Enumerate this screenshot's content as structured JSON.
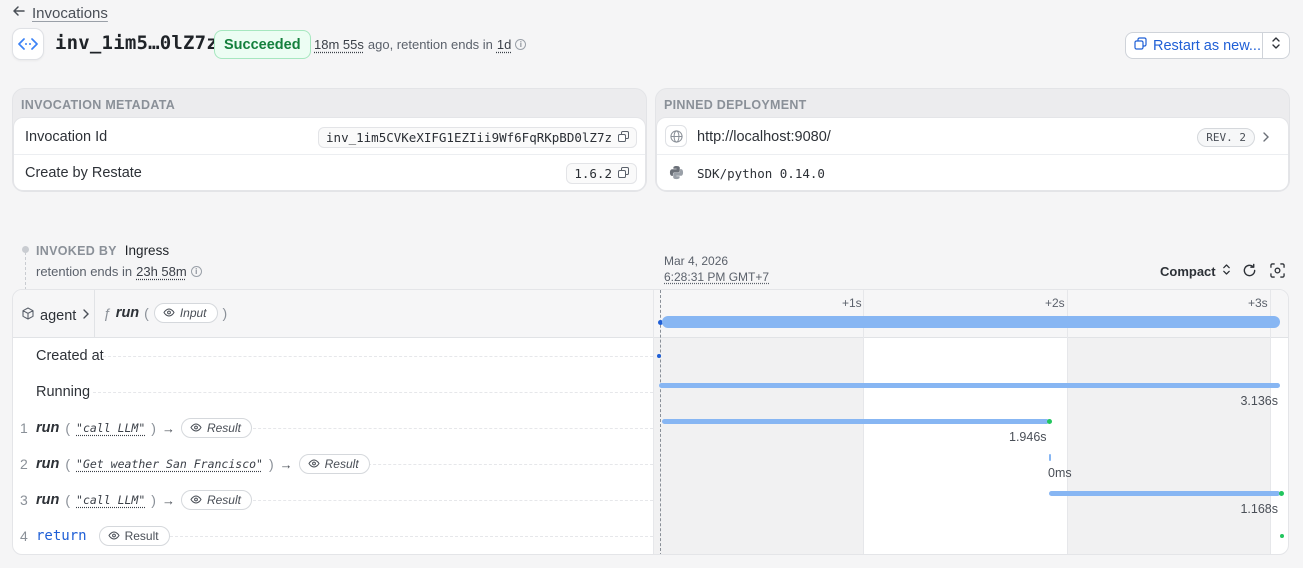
{
  "nav": {
    "back_label": "Invocations"
  },
  "header": {
    "invocation_short": "inv_1im5…0lZ7z",
    "status": "Succeeded",
    "age": "18m 55s",
    "age_suffix": "ago, retention ends in",
    "retention": "1d",
    "restart_label": "Restart as new..."
  },
  "metadata": {
    "title": "INVOCATION METADATA",
    "rows": [
      {
        "label": "Invocation Id",
        "value": "inv_1im5CVKeXIFG1EZIii9Wf6FqRKpBD0lZ7z"
      },
      {
        "label": "Create by Restate",
        "value": "1.6.2"
      }
    ]
  },
  "deployment": {
    "title": "PINNED DEPLOYMENT",
    "url": "http://localhost:9080/",
    "revision": "REV. 2",
    "sdk": "SDK/python 0.14.0"
  },
  "invoked_by": {
    "label": "INVOKED BY",
    "value": "Ingress",
    "retention_prefix": "retention ends in",
    "retention": "23h 58m"
  },
  "timeline_header": {
    "date": "Mar 4, 2026",
    "time": "6:28:31 PM GMT+7",
    "view_mode": "Compact",
    "ticks": [
      "+1s",
      "+2s",
      "+3s"
    ]
  },
  "invocation": {
    "service": "agent",
    "handler": "run",
    "input_label": "Input"
  },
  "lifecycle": [
    {
      "label": "Created at"
    },
    {
      "label": "Running",
      "duration": "3.136s"
    }
  ],
  "steps": [
    {
      "num": "1",
      "fn": "run",
      "arg": "\"call LLM\"",
      "result_label": "Result",
      "duration": "1.946s",
      "start": 0.0,
      "end": 1.946
    },
    {
      "num": "2",
      "fn": "run",
      "arg": "\"Get weather San Francisco\"",
      "result_label": "Result",
      "duration": "0ms",
      "start": 1.946,
      "end": 1.946
    },
    {
      "num": "3",
      "fn": "run",
      "arg": "\"call LLM\"",
      "result_label": "Result",
      "duration": "1.168s",
      "start": 1.946,
      "end": 3.114
    },
    {
      "num": "4",
      "fn": "return",
      "result_label": "Result",
      "start": 3.136,
      "end": 3.136
    }
  ],
  "colors": {
    "accent": "#1f5fd6",
    "bar": "#87b6f3",
    "success": "#22c55e"
  }
}
